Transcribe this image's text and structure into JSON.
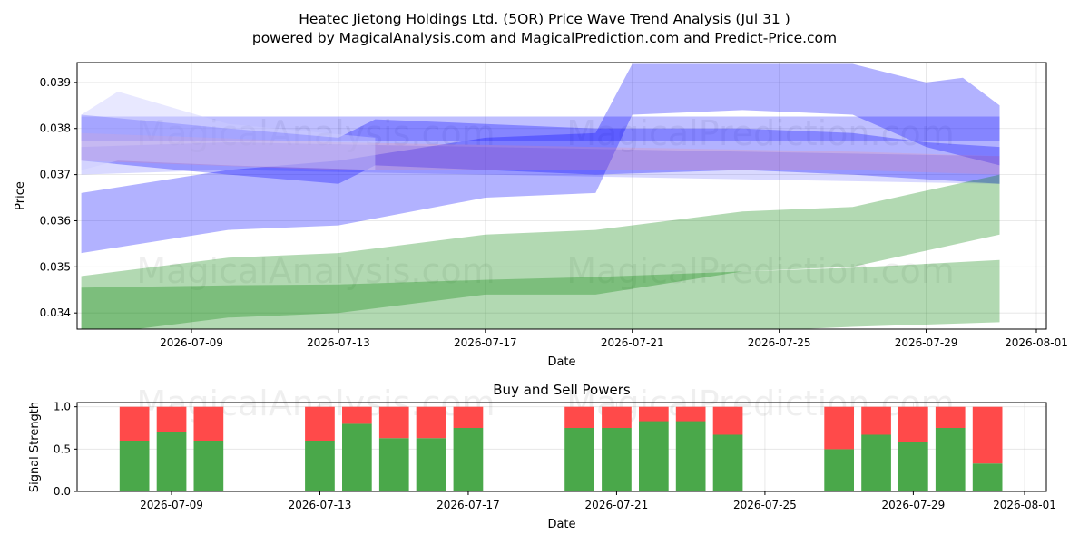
{
  "figure": {
    "title": "Heatec Jietong Holdings Ltd. (5OR) Price Wave Trend Analysis (Jul 31 )",
    "subtitle": "powered by MagicalAnalysis.com and MagicalPrediction.com and Predict-Price.com",
    "watermarks": [
      "MagicalAnalysis.com",
      "MagicalPrediction.com"
    ]
  },
  "chart_data": [
    {
      "type": "area",
      "name": "price-wave-trend",
      "xlabel": "Date",
      "ylabel": "Price",
      "x_range": [
        "2026-07-06",
        "2026-08-01"
      ],
      "ylim": [
        0.03365,
        0.03943
      ],
      "x_ticks": [
        "2026-07-09",
        "2026-07-13",
        "2026-07-17",
        "2026-07-21",
        "2026-07-25",
        "2026-07-29",
        "2026-08-01"
      ],
      "y_ticks": [
        0.034,
        0.035,
        0.036,
        0.037,
        0.038,
        0.039
      ],
      "grid": true,
      "bands": [
        {
          "color": "#0000ff",
          "opacity": 0.3,
          "x": [
            "2026-07-06",
            "2026-07-10",
            "2026-07-13",
            "2026-07-17",
            "2026-07-20",
            "2026-07-21",
            "2026-07-24",
            "2026-07-27",
            "2026-07-29",
            "2026-07-30",
            "2026-07-31"
          ],
          "upper": [
            0.0366,
            0.0371,
            0.0373,
            0.0378,
            0.0379,
            0.0394,
            0.0394,
            0.0394,
            0.039,
            0.0391,
            0.0385
          ],
          "lower": [
            0.0353,
            0.0358,
            0.0359,
            0.0365,
            0.0366,
            0.0383,
            0.0384,
            0.0383,
            0.0376,
            0.0374,
            0.0372
          ]
        },
        {
          "color": "#0000ff",
          "opacity": 0.3,
          "x": [
            "2026-07-06",
            "2026-07-10",
            "2026-07-13",
            "2026-07-14",
            "2026-07-17",
            "2026-07-20",
            "2026-07-24",
            "2026-07-27",
            "2026-07-29",
            "2026-07-31"
          ],
          "upper": [
            0.0383,
            0.038,
            0.0378,
            0.0382,
            0.0381,
            0.038,
            0.038,
            0.0379,
            0.0377,
            0.0376
          ],
          "lower": [
            0.0373,
            0.037,
            0.0368,
            0.0372,
            0.0371,
            0.037,
            0.0371,
            0.037,
            0.0369,
            0.0368
          ]
        },
        {
          "color": "#0000ff",
          "opacity": 0.25,
          "x": [
            "2026-07-06",
            "2026-07-31"
          ],
          "upper": [
            0.03826,
            0.03826
          ],
          "lower": [
            0.03774,
            0.03774
          ]
        },
        {
          "color": "#0000ff",
          "opacity": 0.15,
          "x": [
            "2026-07-06",
            "2026-07-10",
            "2026-07-17",
            "2026-07-24",
            "2026-07-31"
          ],
          "upper": [
            0.0376,
            0.0377,
            0.0376,
            0.0375,
            0.0374
          ],
          "lower": [
            0.037,
            0.0371,
            0.037,
            0.0369,
            0.0368
          ]
        },
        {
          "color": "#ff8888",
          "opacity": 0.2,
          "x": [
            "2026-07-06",
            "2026-07-13",
            "2026-07-20",
            "2026-07-27",
            "2026-07-31"
          ],
          "upper": [
            0.0379,
            0.0377,
            0.0376,
            0.0375,
            0.0374
          ],
          "lower": [
            0.0373,
            0.0371,
            0.0371,
            0.0371,
            0.037
          ]
        },
        {
          "color": "#ccccff",
          "opacity": 0.45,
          "x": [
            "2026-07-06",
            "2026-07-07",
            "2026-07-10",
            "2026-07-14"
          ],
          "upper": [
            0.0383,
            0.0388,
            0.0381,
            0.0378
          ],
          "lower": [
            0.0371,
            0.0373,
            0.0372,
            0.0371
          ]
        },
        {
          "color": "#008000",
          "opacity": 0.3,
          "x": [
            "2026-07-06",
            "2026-07-10",
            "2026-07-13",
            "2026-07-17",
            "2026-07-20",
            "2026-07-24",
            "2026-07-27",
            "2026-07-31"
          ],
          "upper": [
            0.0348,
            0.0352,
            0.0353,
            0.0357,
            0.0358,
            0.0362,
            0.0363,
            0.037
          ],
          "lower": [
            0.0335,
            0.0339,
            0.034,
            0.0344,
            0.0344,
            0.0349,
            0.035,
            0.0357
          ]
        },
        {
          "color": "#008000",
          "opacity": 0.3,
          "x": [
            "2026-07-06",
            "2026-07-10",
            "2026-07-13",
            "2026-07-17",
            "2026-07-20",
            "2026-07-24",
            "2026-07-27",
            "2026-07-31"
          ],
          "upper": [
            0.03455,
            0.0346,
            0.03462,
            0.03472,
            0.03478,
            0.0349,
            0.03498,
            0.03515
          ],
          "lower": [
            0.0333,
            0.0333,
            0.0333,
            0.0334,
            0.0335,
            0.0336,
            0.0337,
            0.0338
          ]
        }
      ]
    },
    {
      "type": "bar",
      "name": "buy-sell-powers",
      "title": "Buy and Sell Powers",
      "xlabel": "Date",
      "ylabel": "Signal Strength",
      "ylim": [
        0,
        1.05
      ],
      "y_ticks": [
        0.0,
        0.5,
        1.0
      ],
      "x_ticks": [
        "2026-07-09",
        "2026-07-13",
        "2026-07-17",
        "2026-07-21",
        "2026-07-25",
        "2026-07-29",
        "2026-08-01"
      ],
      "grid": true,
      "series": [
        {
          "name": "buy",
          "color": "#4aa84a"
        },
        {
          "name": "sell",
          "color": "#ff4a4a"
        }
      ],
      "bars": [
        {
          "date": "2026-07-08",
          "buy": 0.6
        },
        {
          "date": "2026-07-09",
          "buy": 0.7
        },
        {
          "date": "2026-07-10",
          "buy": 0.6
        },
        {
          "date": "2026-07-13",
          "buy": 0.6
        },
        {
          "date": "2026-07-14",
          "buy": 0.8
        },
        {
          "date": "2026-07-15",
          "buy": 0.63
        },
        {
          "date": "2026-07-16",
          "buy": 0.63
        },
        {
          "date": "2026-07-17",
          "buy": 0.75
        },
        {
          "date": "2026-07-20",
          "buy": 0.75
        },
        {
          "date": "2026-07-21",
          "buy": 0.75
        },
        {
          "date": "2026-07-22",
          "buy": 0.83
        },
        {
          "date": "2026-07-23",
          "buy": 0.83
        },
        {
          "date": "2026-07-24",
          "buy": 0.67
        },
        {
          "date": "2026-07-27",
          "buy": 0.5
        },
        {
          "date": "2026-07-28",
          "buy": 0.67
        },
        {
          "date": "2026-07-29",
          "buy": 0.58
        },
        {
          "date": "2026-07-30",
          "buy": 0.75
        },
        {
          "date": "2026-07-31",
          "buy": 0.33
        }
      ]
    }
  ]
}
